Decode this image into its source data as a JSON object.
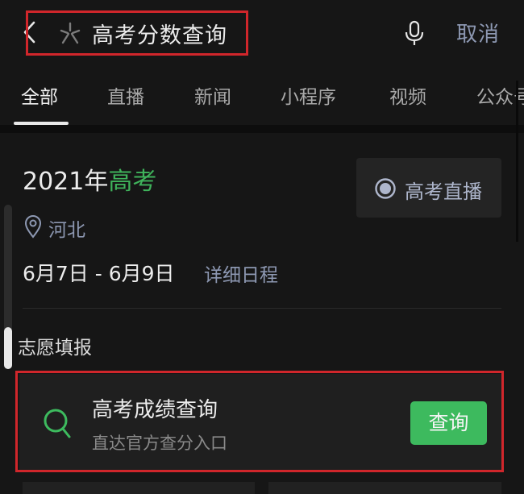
{
  "header": {
    "query": "高考分数查询",
    "cancel_label": "取消",
    "icons": {
      "back": "chevron-left-icon",
      "search_logo": "wechat-search-icon",
      "mic": "microphone-icon"
    }
  },
  "tabs": [
    {
      "label": "全部",
      "active": true
    },
    {
      "label": "直播",
      "active": false
    },
    {
      "label": "新闻",
      "active": false
    },
    {
      "label": "小程序",
      "active": false
    },
    {
      "label": "视频",
      "active": false
    },
    {
      "label": "公众号",
      "active": false
    }
  ],
  "event": {
    "title_prefix": "2021年",
    "title_highlight": "高考",
    "location": "河北",
    "dates": "6月7日 - 6月9日",
    "details_link": "详细日程",
    "live_button_label": "高考直播"
  },
  "section": {
    "title": "志愿填报",
    "card": {
      "title": "高考成绩查询",
      "subtitle": "直达官方查分入口",
      "button_label": "查询"
    }
  },
  "colors": {
    "accent_green": "#3dba5e",
    "link_blue_gray": "#8d98b2",
    "highlight_red": "#d0262b",
    "background": "#161616"
  }
}
